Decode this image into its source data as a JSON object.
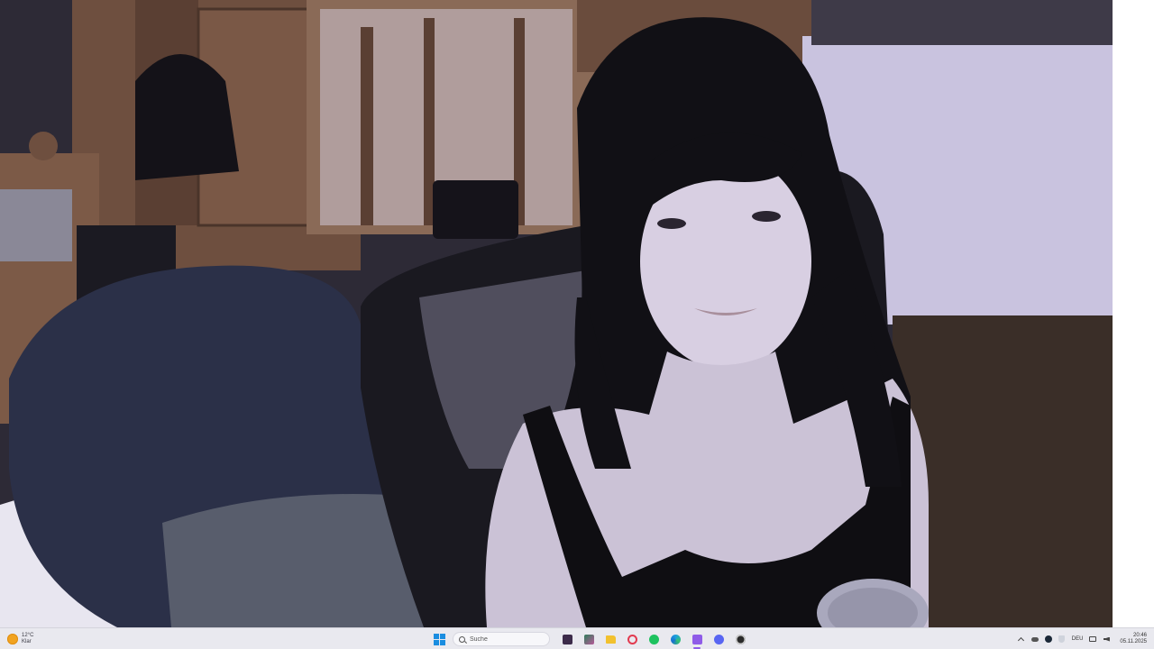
{
  "taskbar": {
    "weather": {
      "temperature": "12°C",
      "condition": "Klar",
      "icon": "sun-icon"
    },
    "search": {
      "placeholder": "Suche"
    },
    "apps": [
      {
        "name": "start-icon"
      },
      {
        "name": "terminal-icon"
      },
      {
        "name": "widgets-icon"
      },
      {
        "name": "folder-icon"
      },
      {
        "name": "opera-icon"
      },
      {
        "name": "spotify-icon"
      },
      {
        "name": "edge-icon"
      },
      {
        "name": "twitch-icon"
      },
      {
        "name": "discord-icon"
      },
      {
        "name": "obs-icon"
      }
    ],
    "tray": {
      "language": "DEU",
      "time": "20:46",
      "date": "05.11.2025"
    }
  },
  "colors": {
    "taskbar_bg": "#e9e9ef",
    "accent_active": "#8f5be8"
  }
}
